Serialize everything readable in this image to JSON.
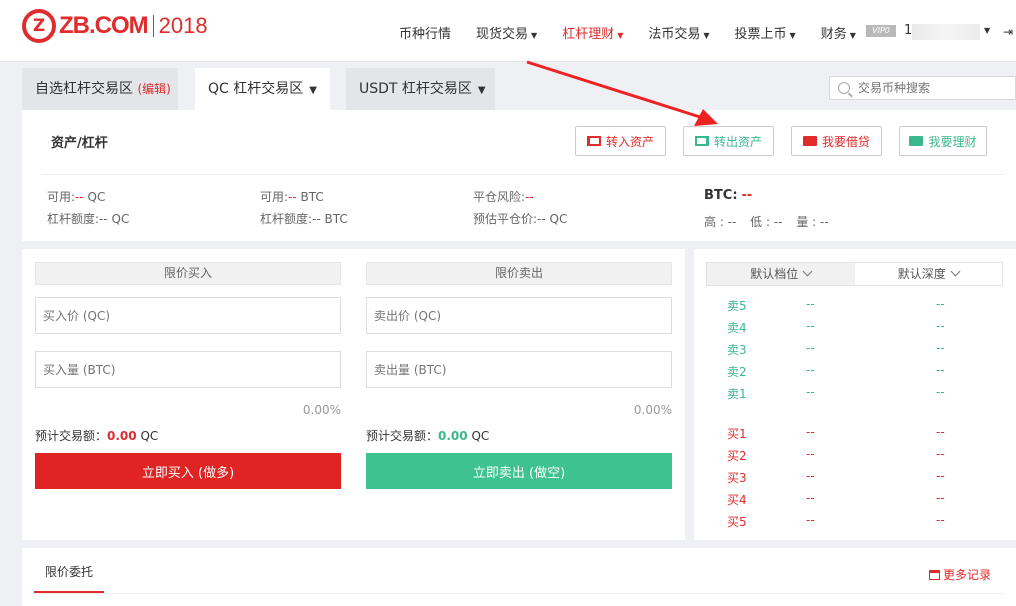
{
  "header": {
    "logo_mark": "Z",
    "logo_text": "ZB.COM",
    "logo_year": "2018",
    "nav": [
      {
        "label": "币种行情",
        "caret": false,
        "active": false
      },
      {
        "label": "现货交易",
        "caret": true,
        "active": false
      },
      {
        "label": "杠杆理财",
        "caret": true,
        "active": true
      },
      {
        "label": "法币交易",
        "caret": true,
        "active": false
      },
      {
        "label": "投票上币",
        "caret": true,
        "active": false
      },
      {
        "label": "财务",
        "caret": true,
        "active": false
      }
    ],
    "vip_badge": "VIP0",
    "user_initial": "1"
  },
  "tabs": {
    "favorites_label": "自选杠杆交易区",
    "favorites_edit": "(编辑)",
    "qc_label": "QC 杠杆交易区",
    "usdt_label": "USDT 杠杆交易区"
  },
  "search": {
    "placeholder": "交易币种搜索"
  },
  "asset": {
    "title": "资产/杠杆",
    "buttons": {
      "transfer_in": "转入资产",
      "transfer_out": "转出资产",
      "borrow": "我要借贷",
      "invest": "我要理财"
    },
    "available_qc_label": "可用:",
    "available_qc_value": "--",
    "available_qc_unit": " QC",
    "limit_qc_label": "杠杆额度:",
    "limit_qc_value": "--",
    "limit_qc_unit": " QC",
    "available_btc_label": "可用:",
    "available_btc_value": "--",
    "available_btc_unit": " BTC",
    "limit_btc_label": "杠杆额度:",
    "limit_btc_value": "--",
    "limit_btc_unit": " BTC",
    "risk_label": "平仓风险:",
    "risk_value": "--",
    "liq_price_label": "预估平仓价:",
    "liq_price_value": "--",
    "liq_price_unit": " QC",
    "btc_label": "BTC:",
    "btc_value": "--",
    "high": "高 : --",
    "low": "低 : --",
    "volume": "量 : --"
  },
  "buy_form": {
    "header": "限价买入",
    "price_placeholder": "买入价 (QC)",
    "amount_placeholder": "买入量 (BTC)",
    "percent": "0.00%",
    "est_label": "预计交易额：",
    "est_value": "0.00",
    "est_unit": " QC",
    "submit": "立即买入 (做多)"
  },
  "sell_form": {
    "header": "限价卖出",
    "price_placeholder": "卖出价 (QC)",
    "amount_placeholder": "卖出量 (BTC)",
    "percent": "0.00%",
    "est_label": "预计交易额：",
    "est_value": "0.00",
    "est_unit": " QC",
    "submit": "立即卖出 (做空)"
  },
  "order_book": {
    "tab_levels": "默认档位",
    "tab_depth": "默认深度",
    "asks": [
      {
        "label": "卖5",
        "price": "--",
        "amount": "--"
      },
      {
        "label": "卖4",
        "price": "--",
        "amount": "--"
      },
      {
        "label": "卖3",
        "price": "--",
        "amount": "--"
      },
      {
        "label": "卖2",
        "price": "--",
        "amount": "--"
      },
      {
        "label": "卖1",
        "price": "--",
        "amount": "--"
      }
    ],
    "bids": [
      {
        "label": "买1",
        "price": "--",
        "amount": "--"
      },
      {
        "label": "买2",
        "price": "--",
        "amount": "--"
      },
      {
        "label": "买3",
        "price": "--",
        "amount": "--"
      },
      {
        "label": "买4",
        "price": "--",
        "amount": "--"
      },
      {
        "label": "买5",
        "price": "--",
        "amount": "--"
      }
    ]
  },
  "bottom": {
    "tab_label": "限价委托",
    "more_label": "更多记录"
  },
  "colors": {
    "brand_red": "#e02c2c",
    "buy_green": "#3ab88d",
    "annotation_arrow": "#ee2222"
  }
}
